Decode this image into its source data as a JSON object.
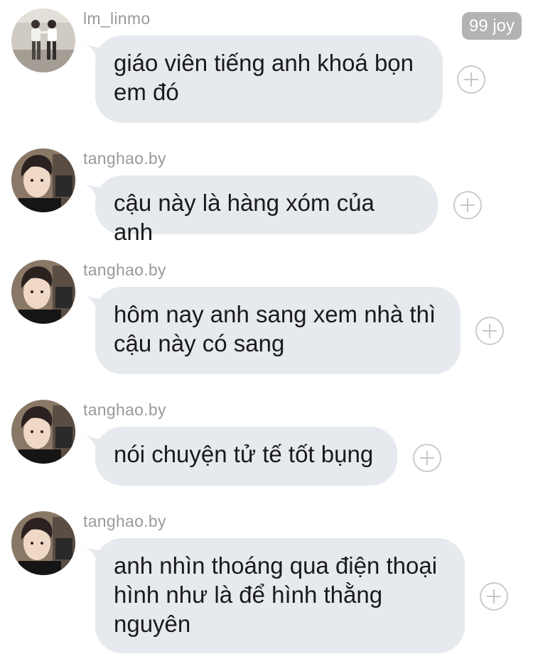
{
  "top_badge": {
    "text": "99 joy"
  },
  "messages": [
    {
      "username": "lm_linmo",
      "avatar": "dance-couple-avatar",
      "lines": [
        "giáo viên tiếng anh khoá bọn",
        "em đó"
      ]
    },
    {
      "username": "tanghao.by",
      "avatar": "man-selfie-avatar",
      "lines": [
        "cậu này là hàng xóm của anh"
      ]
    },
    {
      "username": "tanghao.by",
      "avatar": "man-selfie-avatar",
      "lines": [
        "hôm nay anh sang xem nhà thì",
        "cậu này có sang"
      ]
    },
    {
      "username": "tanghao.by",
      "avatar": "man-selfie-avatar",
      "lines": [
        "nói chuyện tử tế tốt bụng"
      ]
    },
    {
      "username": "tanghao.by",
      "avatar": "man-selfie-avatar",
      "lines": [
        "anh nhìn thoáng qua điện thoại",
        "hình như là để hình thằng",
        "nguyên"
      ]
    }
  ],
  "icons": {
    "add_reaction": "plus-circle-icon"
  },
  "colors": {
    "bubble": "#e6e9ed",
    "username": "#9a9a9a",
    "badge": "#b3b3b3",
    "text": "#1a1a1a"
  }
}
